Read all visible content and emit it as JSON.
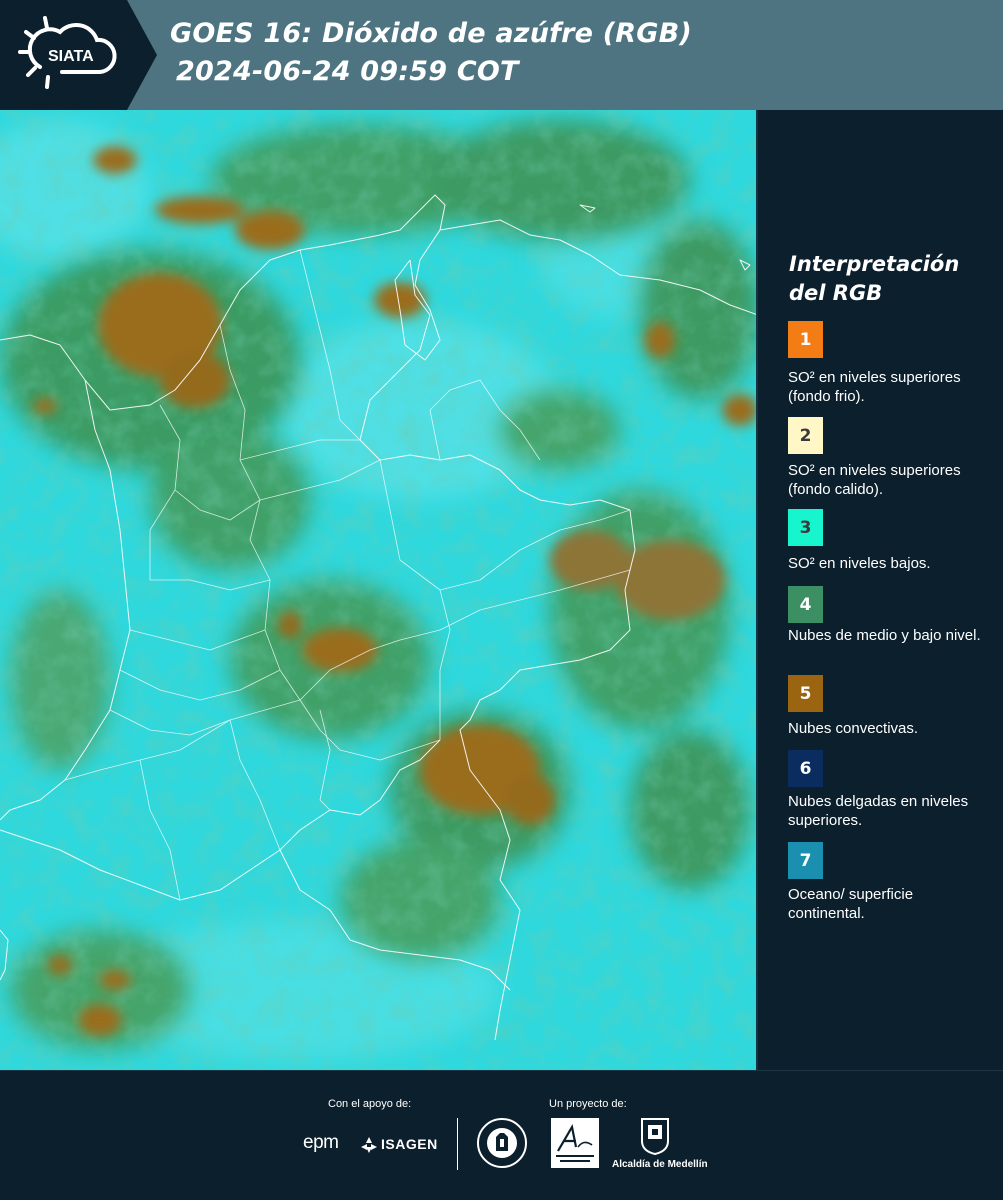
{
  "header": {
    "logo_text": "SIATA",
    "title_line1": "GOES 16: Dióxido de azúfre (RGB)",
    "title_line2": "2024-06-24 09:59 COT"
  },
  "legend": {
    "title_line1": "Interpretación",
    "title_line2": "del RGB",
    "items": [
      {
        "number": "1",
        "color": "#f47c14",
        "number_color": "#ffffff",
        "label": "SO² en niveles superiores (fondo frio)."
      },
      {
        "number": "2",
        "color": "#fff8c6",
        "number_color": "#3a3a3a",
        "label": "SO² en niveles superiores (fondo calido)."
      },
      {
        "number": "3",
        "color": "#17f5cf",
        "number_color": "#3a3a3a",
        "label": "SO² en niveles bajos."
      },
      {
        "number": "4",
        "color": "#3b8f62",
        "number_color": "#ffffff",
        "label": "Nubes de medio y bajo nivel."
      },
      {
        "number": "5",
        "color": "#9a6410",
        "number_color": "#ffffff",
        "label": "Nubes convectivas."
      },
      {
        "number": "6",
        "color": "#0b2c5e",
        "number_color": "#ffffff",
        "label": "Nubes delgadas en niveles superiores."
      },
      {
        "number": "7",
        "color": "#1b8fb0",
        "number_color": "#ffffff",
        "label": "Oceano/ superficie continental."
      }
    ]
  },
  "footer": {
    "support_caption": "Con el apoyo de:",
    "project_caption": "Un proyecto de:",
    "sponsors": [
      "epm",
      "ISAGEN"
    ],
    "partners": [
      "Alcaldía de Medellín"
    ]
  },
  "colors": {
    "header_band": "#4d7480",
    "panel_bg": "#0c1f2c",
    "map_base": "#2fd7dc",
    "cloud_green": "#3c9a62",
    "convective_brown": "#9a6d1c",
    "borders": "#ffffff"
  }
}
